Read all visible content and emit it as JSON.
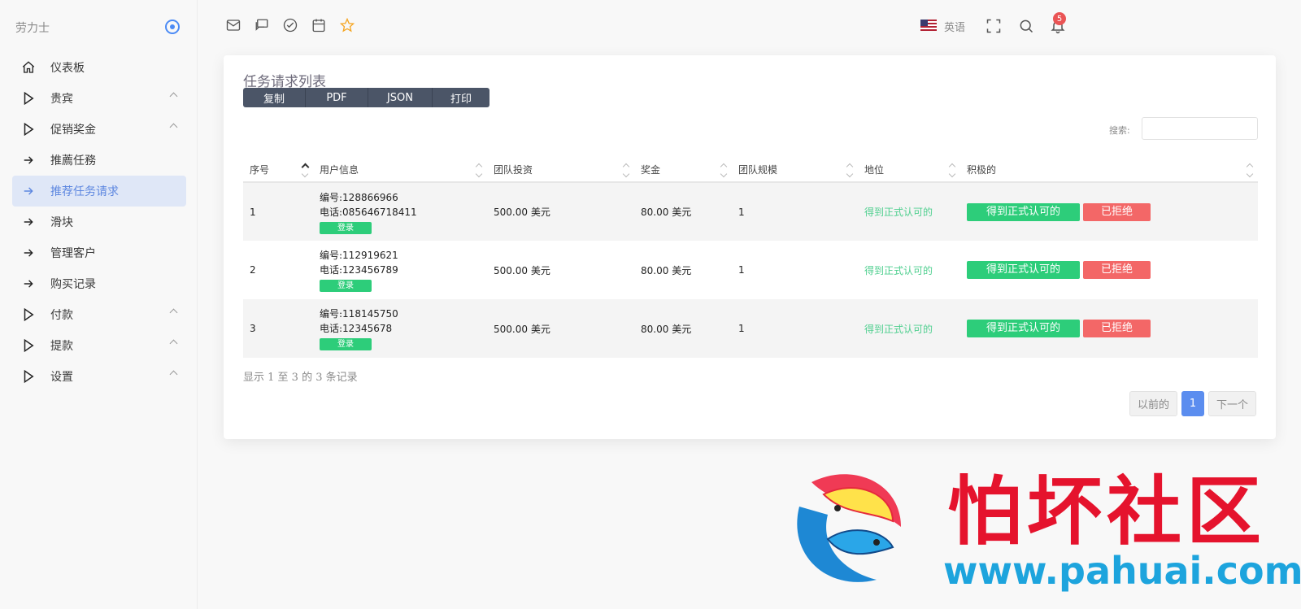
{
  "brand": {
    "name": "劳力士"
  },
  "sidebar": {
    "items": [
      {
        "label": "仪表板",
        "icon": "home-icon",
        "chevron": false,
        "active": false
      },
      {
        "label": "贵宾",
        "icon": "play-icon",
        "chevron": true,
        "active": false
      },
      {
        "label": "促销奖金",
        "icon": "play-icon",
        "chevron": true,
        "active": false
      },
      {
        "label": "推薦任務",
        "icon": "arrow-right-icon",
        "chevron": false,
        "active": false
      },
      {
        "label": "推荐任务请求",
        "icon": "arrow-right-icon",
        "chevron": false,
        "active": true
      },
      {
        "label": "滑块",
        "icon": "arrow-right-icon",
        "chevron": false,
        "active": false
      },
      {
        "label": "管理客户",
        "icon": "arrow-right-icon",
        "chevron": false,
        "active": false
      },
      {
        "label": "购买记录",
        "icon": "arrow-right-icon",
        "chevron": false,
        "active": false
      },
      {
        "label": "付款",
        "icon": "play-icon",
        "chevron": true,
        "active": false
      },
      {
        "label": "提款",
        "icon": "play-icon",
        "chevron": true,
        "active": false
      },
      {
        "label": "设置",
        "icon": "play-icon",
        "chevron": true,
        "active": false
      }
    ]
  },
  "topbar": {
    "language": "英语",
    "notification_count": "5"
  },
  "card": {
    "title": "任务请求列表",
    "export_buttons": [
      "复制",
      "PDF",
      "JSON",
      "打印"
    ],
    "search_label": "搜索:",
    "search_value": ""
  },
  "table": {
    "columns": [
      "序号",
      "用户信息",
      "团队投资",
      "奖金",
      "团队规模",
      "地位",
      "积极的"
    ],
    "rows": [
      {
        "index": "1",
        "id_label": "编号:",
        "id": "128866966",
        "phone_label": "电话:",
        "phone": "085646718411",
        "login": "登录",
        "investment": "500.00",
        "investment_unit": "美元",
        "bonus": "80.00",
        "bonus_unit": "美元",
        "team_size": "1",
        "status": "得到正式认可的",
        "approve": "得到正式认可的",
        "reject": "已拒绝"
      },
      {
        "index": "2",
        "id_label": "编号:",
        "id": "112919621",
        "phone_label": "电话:",
        "phone": "123456789",
        "login": "登录",
        "investment": "500.00",
        "investment_unit": "美元",
        "bonus": "80.00",
        "bonus_unit": "美元",
        "team_size": "1",
        "status": "得到正式认可的",
        "approve": "得到正式认可的",
        "reject": "已拒绝"
      },
      {
        "index": "3",
        "id_label": "编号:",
        "id": "118145750",
        "phone_label": "电话:",
        "phone": "12345678",
        "login": "登录",
        "investment": "500.00",
        "investment_unit": "美元",
        "bonus": "80.00",
        "bonus_unit": "美元",
        "team_size": "1",
        "status": "得到正式认可的",
        "approve": "得到正式认可的",
        "reject": "已拒绝"
      }
    ],
    "info": "显示 1 至 3 的 3 条记录"
  },
  "pagination": {
    "prev": "以前的",
    "current": "1",
    "next": "下一个"
  },
  "watermark": {
    "title": "怕坏社区",
    "url": "www.pahuai.com"
  },
  "colors": {
    "accent": "#5b8def",
    "success": "#2dcd7a",
    "danger": "#f36767",
    "dark": "#4b5567"
  }
}
